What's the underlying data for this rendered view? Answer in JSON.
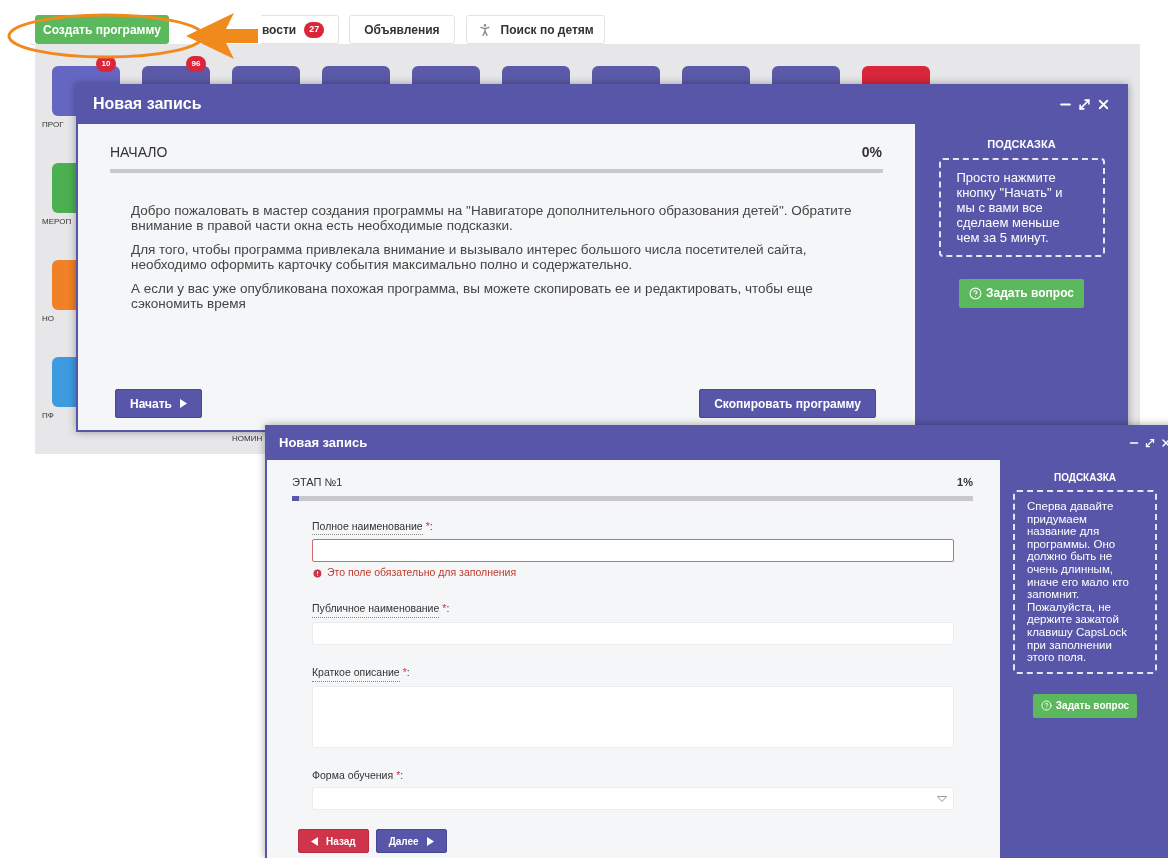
{
  "top_bar": {
    "buttons": [
      {
        "kind": "primary",
        "label": "Создать программу"
      },
      {
        "kind": "default",
        "label": "вости",
        "badge": "27"
      },
      {
        "kind": "default",
        "label": "Объявления"
      },
      {
        "kind": "person",
        "label": "Поиск по детям"
      }
    ]
  },
  "dashboard": {
    "top_row": [
      {
        "color": "#6466c2",
        "badge": "10",
        "label": "ПРОГ"
      },
      {
        "color": "#5b5aa8",
        "badge": "96"
      },
      {
        "color": "#5b5aa8"
      },
      {
        "color": "#5b5aa8"
      },
      {
        "color": "#5b5aa8"
      },
      {
        "color": "#5b5aa8"
      },
      {
        "color": "#5b5aa8"
      },
      {
        "color": "#5b5aa8"
      },
      {
        "color": "#5b5aa8"
      },
      {
        "color": "#d9263b"
      }
    ],
    "left_column": [
      {
        "color": "#4caf50",
        "label": "МЕРОП"
      },
      {
        "color": "#f08127",
        "label": "НО"
      },
      {
        "color": "#3d9be0",
        "label": "ПФ"
      }
    ],
    "lower_label": "НОМИН"
  },
  "start_dialog": {
    "title": "Новая запись",
    "step": "НАЧАЛО",
    "percent": "0%",
    "level": 0,
    "paragraphs": [
      "Добро пожаловать в мастер создания программы на \"Навигаторе дополнительного образования детей\". Обратите внимание в правой части окна есть необходимые подсказки.",
      "Для того, чтобы программа привлекала внимание и вызывало интерес большого числа посетителей сайта, необходимо оформить карточку события максимально полно и содержательно.",
      "А если у вас уже опубликована похожая программа, вы можете скопировать ее и редактировать, чтобы еще сэкономить время"
    ],
    "buttons": [
      {
        "kind": "next",
        "label": "Начать"
      },
      {
        "kind": "plain",
        "label": "Скопировать программу"
      }
    ],
    "hint": {
      "title": "ПОДСКАЗКА",
      "text": "Просто нажмите кнопку \"Начать\" и мы с вами все сделаем меньше чем за 5 минут.",
      "button": "Задать вопрос"
    }
  },
  "step_dialog": {
    "title": "Новая запись",
    "step": "ЭТАП №1",
    "percent": "1%",
    "level": 0.01,
    "fields": [
      {
        "kind": "text",
        "label": "Полное наименование",
        "required_mark": "*",
        "suffix": ":",
        "tooltip": true,
        "invalid": true,
        "error": "Это поле обязательно для заполнения"
      },
      {
        "kind": "text",
        "label": "Публичное наименование",
        "required_mark": "*",
        "suffix": ":",
        "tooltip": true,
        "invalid": false
      },
      {
        "kind": "textarea",
        "label": "Краткое описание",
        "required_mark": "*",
        "suffix": ":",
        "tooltip": true,
        "invalid": false
      },
      {
        "kind": "select",
        "label": "Форма обучения",
        "required_mark": "*",
        "suffix": ":",
        "tooltip": false,
        "invalid": false
      }
    ],
    "buttons": [
      {
        "kind": "back",
        "label": "Назад"
      },
      {
        "kind": "next",
        "label": "Далее"
      }
    ],
    "hint": {
      "title": "ПОДСКАЗКА",
      "text": "Сперва давайте придумаем название для программы. Оно должно быть не очень длинным, иначе его мало кто запомнит. Пожалуйста, не держите зажатой клавишу CapsLock при заполнении этого поля.",
      "button": "Задать вопрос"
    }
  }
}
